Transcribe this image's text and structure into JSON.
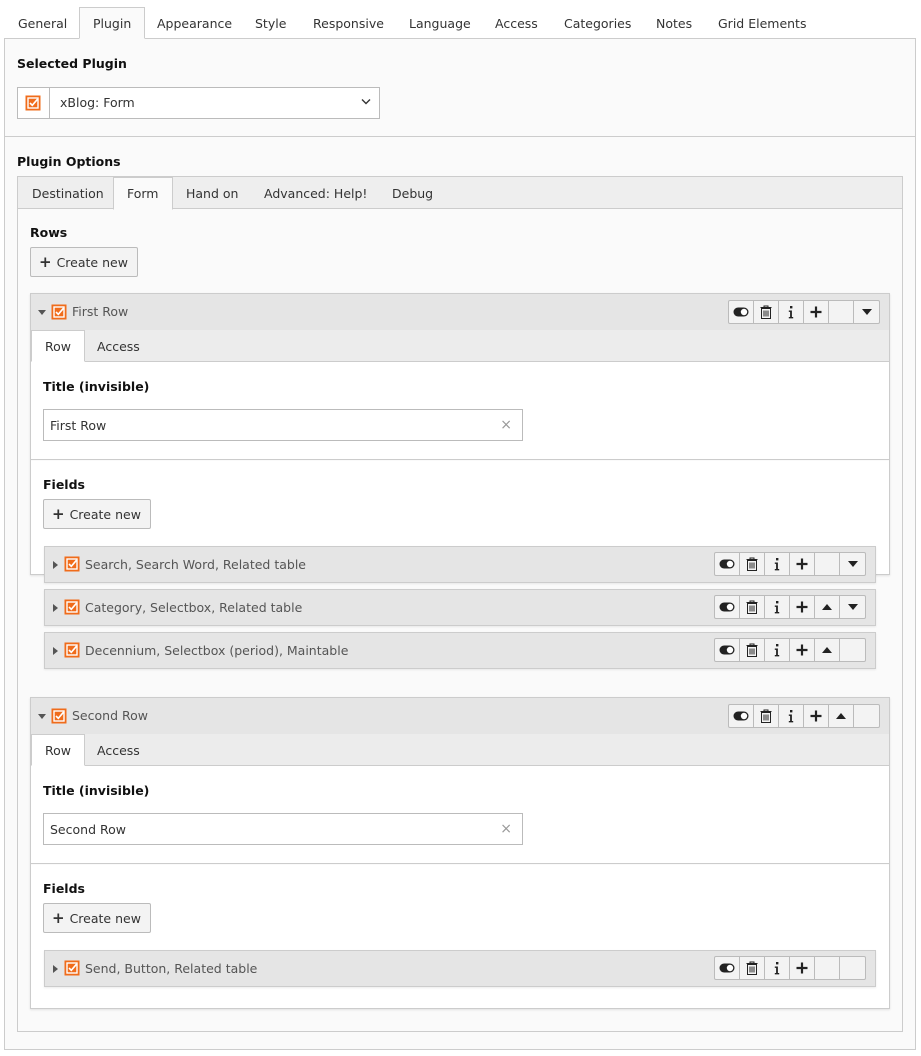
{
  "outer_tabs": [
    "General",
    "Plugin",
    "Appearance",
    "Style",
    "Responsive",
    "Language",
    "Access",
    "Categories",
    "Notes",
    "Grid Elements"
  ],
  "selected_plugin": {
    "label": "Selected Plugin",
    "value": "xBlog: Form"
  },
  "plugin_options": {
    "label": "Plugin Options",
    "tabs": [
      "Destination",
      "Form",
      "Hand on",
      "Advanced: Help!",
      "Debug"
    ],
    "rows_label": "Rows",
    "create_new": "Create new",
    "rows": [
      {
        "title": "First Row",
        "tabs": [
          "Row",
          "Access"
        ],
        "title_label": "Title (invisible)",
        "title_value": "First Row",
        "fields_label": "Fields",
        "create_new": "Create new",
        "fields": [
          {
            "title": "Search, Search Word, Related table"
          },
          {
            "title": "Category, Selectbox, Related table"
          },
          {
            "title": "Decennium, Selectbox (period), Maintable"
          }
        ]
      },
      {
        "title": "Second Row",
        "tabs": [
          "Row",
          "Access"
        ],
        "title_label": "Title (invisible)",
        "title_value": "Second Row",
        "fields_label": "Fields",
        "create_new": "Create new",
        "fields": [
          {
            "title": "Send, Button, Related table"
          }
        ]
      }
    ]
  },
  "icons": {
    "record": "content-element-checkbox-icon",
    "toggle": "toggle-visibility-icon",
    "delete": "trash-icon",
    "info": "info-icon",
    "add": "plus-icon",
    "move_up": "move-up-icon",
    "move_down": "move-down-icon"
  },
  "colors": {
    "accent": "#f06c1b",
    "panel": "#fafafa",
    "header": "#e5e5e5"
  }
}
